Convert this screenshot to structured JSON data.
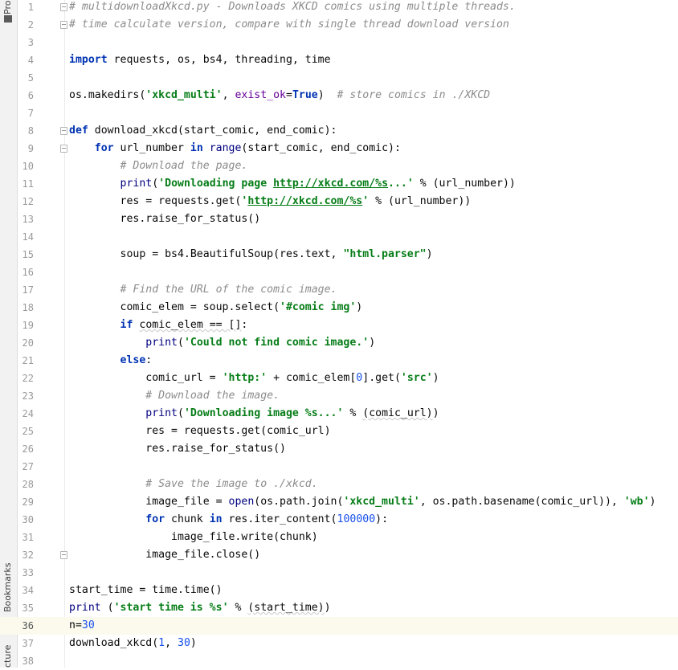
{
  "sidebar": {
    "tabs": [
      {
        "label": "Pro",
        "icon": "folder-icon"
      },
      {
        "label": "Bookmarks",
        "icon": "bookmark-icon"
      },
      {
        "label": "cture",
        "icon": "structure-icon"
      }
    ]
  },
  "editor": {
    "current_line": 36,
    "lines": [
      {
        "n": "1",
        "fold": "open",
        "tokens": [
          {
            "t": "# multidownloadXkcd.py - Downloads XKCD comics using multiple threads.",
            "c": "cm"
          }
        ]
      },
      {
        "n": "2",
        "fold": "close",
        "tokens": [
          {
            "t": "# time calculate version, compare with single thread download version",
            "c": "cm"
          }
        ]
      },
      {
        "n": "3",
        "tokens": []
      },
      {
        "n": "4",
        "tokens": [
          {
            "t": "import",
            "c": "kw"
          },
          {
            "t": " requests, os, bs4, threading, time"
          }
        ]
      },
      {
        "n": "5",
        "tokens": []
      },
      {
        "n": "6",
        "tokens": [
          {
            "t": "os.makedirs("
          },
          {
            "t": "'xkcd_multi'",
            "c": "str"
          },
          {
            "t": ", "
          },
          {
            "t": "exist_ok",
            "c": "kwarg"
          },
          {
            "t": "="
          },
          {
            "t": "True",
            "c": "kw"
          },
          {
            "t": ")  "
          },
          {
            "t": "# store comics in ./XKCD",
            "c": "cm"
          }
        ]
      },
      {
        "n": "7",
        "tokens": []
      },
      {
        "n": "8",
        "fold": "open",
        "tokens": [
          {
            "t": "def",
            "c": "kw"
          },
          {
            "t": " download_xkcd(start_comic, end_comic):"
          }
        ]
      },
      {
        "n": "9",
        "fold": "open",
        "tokens": [
          {
            "t": "    "
          },
          {
            "t": "for",
            "c": "kw"
          },
          {
            "t": " url_number "
          },
          {
            "t": "in",
            "c": "kw"
          },
          {
            "t": " "
          },
          {
            "t": "range",
            "c": "bi"
          },
          {
            "t": "(start_comic, end_comic):"
          }
        ]
      },
      {
        "n": "10",
        "tokens": [
          {
            "t": "        "
          },
          {
            "t": "# Download the page.",
            "c": "cm"
          }
        ]
      },
      {
        "n": "11",
        "tokens": [
          {
            "t": "        "
          },
          {
            "t": "print",
            "c": "bi"
          },
          {
            "t": "("
          },
          {
            "t": "'Downloading page ",
            "c": "str"
          },
          {
            "t": "http://xkcd.com/%s",
            "c": "str url"
          },
          {
            "t": "...'",
            "c": "str"
          },
          {
            "t": " % (url_number))"
          }
        ]
      },
      {
        "n": "12",
        "tokens": [
          {
            "t": "        res = requests.get("
          },
          {
            "t": "'",
            "c": "str"
          },
          {
            "t": "http://xkcd.com/%s",
            "c": "str url"
          },
          {
            "t": "'",
            "c": "str"
          },
          {
            "t": " % (url_number))"
          }
        ]
      },
      {
        "n": "13",
        "tokens": [
          {
            "t": "        res.raise_for_status()"
          }
        ]
      },
      {
        "n": "14",
        "tokens": []
      },
      {
        "n": "15",
        "tokens": [
          {
            "t": "        soup = bs4.BeautifulSoup(res.text, "
          },
          {
            "t": "\"html.parser\"",
            "c": "str"
          },
          {
            "t": ")"
          }
        ]
      },
      {
        "n": "16",
        "tokens": []
      },
      {
        "n": "17",
        "tokens": [
          {
            "t": "        "
          },
          {
            "t": "# Find the URL of the comic image.",
            "c": "cm"
          }
        ]
      },
      {
        "n": "18",
        "tokens": [
          {
            "t": "        comic_elem = soup.select("
          },
          {
            "t": "'#comic img'",
            "c": "str"
          },
          {
            "t": ")"
          }
        ]
      },
      {
        "n": "19",
        "tokens": [
          {
            "t": "        "
          },
          {
            "t": "if",
            "c": "kw"
          },
          {
            "t": " "
          },
          {
            "t": "comic_elem == []",
            "c": "warn"
          },
          {
            "t": ":"
          }
        ]
      },
      {
        "n": "20",
        "tokens": [
          {
            "t": "            "
          },
          {
            "t": "print",
            "c": "bi"
          },
          {
            "t": "("
          },
          {
            "t": "'Could not find comic image.'",
            "c": "str"
          },
          {
            "t": ")"
          }
        ]
      },
      {
        "n": "21",
        "tokens": [
          {
            "t": "        "
          },
          {
            "t": "else",
            "c": "kw"
          },
          {
            "t": ":"
          }
        ]
      },
      {
        "n": "22",
        "tokens": [
          {
            "t": "            comic_url = "
          },
          {
            "t": "'http:'",
            "c": "str"
          },
          {
            "t": " + comic_elem["
          },
          {
            "t": "0",
            "c": "num"
          },
          {
            "t": "].get("
          },
          {
            "t": "'src'",
            "c": "str"
          },
          {
            "t": ")"
          }
        ]
      },
      {
        "n": "23",
        "tokens": [
          {
            "t": "            "
          },
          {
            "t": "# Download the image.",
            "c": "cm"
          }
        ]
      },
      {
        "n": "24",
        "tokens": [
          {
            "t": "            "
          },
          {
            "t": "print",
            "c": "bi"
          },
          {
            "t": "("
          },
          {
            "t": "'Downloading image %s...'",
            "c": "str"
          },
          {
            "t": " % "
          },
          {
            "t": "(comic_url)",
            "c": "warn"
          },
          {
            "t": ")"
          }
        ]
      },
      {
        "n": "25",
        "tokens": [
          {
            "t": "            res = requests.get(comic_url)"
          }
        ]
      },
      {
        "n": "26",
        "tokens": [
          {
            "t": "            res.raise_for_status()"
          }
        ]
      },
      {
        "n": "27",
        "tokens": []
      },
      {
        "n": "28",
        "tokens": [
          {
            "t": "            "
          },
          {
            "t": "# Save the image to ./xkcd.",
            "c": "cm"
          }
        ]
      },
      {
        "n": "29",
        "tokens": [
          {
            "t": "            image_file = "
          },
          {
            "t": "open",
            "c": "bi"
          },
          {
            "t": "(os.path.join("
          },
          {
            "t": "'xkcd_multi'",
            "c": "str"
          },
          {
            "t": ", os.path.basename(comic_url)), "
          },
          {
            "t": "'wb'",
            "c": "str"
          },
          {
            "t": ")"
          }
        ]
      },
      {
        "n": "30",
        "tokens": [
          {
            "t": "            "
          },
          {
            "t": "for",
            "c": "kw"
          },
          {
            "t": " chunk "
          },
          {
            "t": "in",
            "c": "kw"
          },
          {
            "t": " res.iter_content("
          },
          {
            "t": "100000",
            "c": "num"
          },
          {
            "t": "):"
          }
        ]
      },
      {
        "n": "31",
        "tokens": [
          {
            "t": "                image_file.write(chunk)"
          }
        ]
      },
      {
        "n": "32",
        "fold": "close",
        "tokens": [
          {
            "t": "            image_file.close()"
          }
        ]
      },
      {
        "n": "33",
        "tokens": []
      },
      {
        "n": "34",
        "tokens": [
          {
            "t": "start_time = time.time()"
          }
        ]
      },
      {
        "n": "35",
        "tokens": [
          {
            "t": "print",
            "c": "bi"
          },
          {
            "t": " ("
          },
          {
            "t": "'start time is %s'",
            "c": "str"
          },
          {
            "t": " % "
          },
          {
            "t": "(start_time)",
            "c": "warn"
          },
          {
            "t": ")"
          }
        ]
      },
      {
        "n": "36",
        "tokens": [
          {
            "t": "n="
          },
          {
            "t": "30",
            "c": "num"
          }
        ]
      },
      {
        "n": "37",
        "tokens": [
          {
            "t": "download_xkcd("
          },
          {
            "t": "1",
            "c": "num"
          },
          {
            "t": ", "
          },
          {
            "t": "30",
            "c": "num"
          },
          {
            "t": ")"
          }
        ]
      },
      {
        "n": "38",
        "tokens": []
      }
    ]
  }
}
